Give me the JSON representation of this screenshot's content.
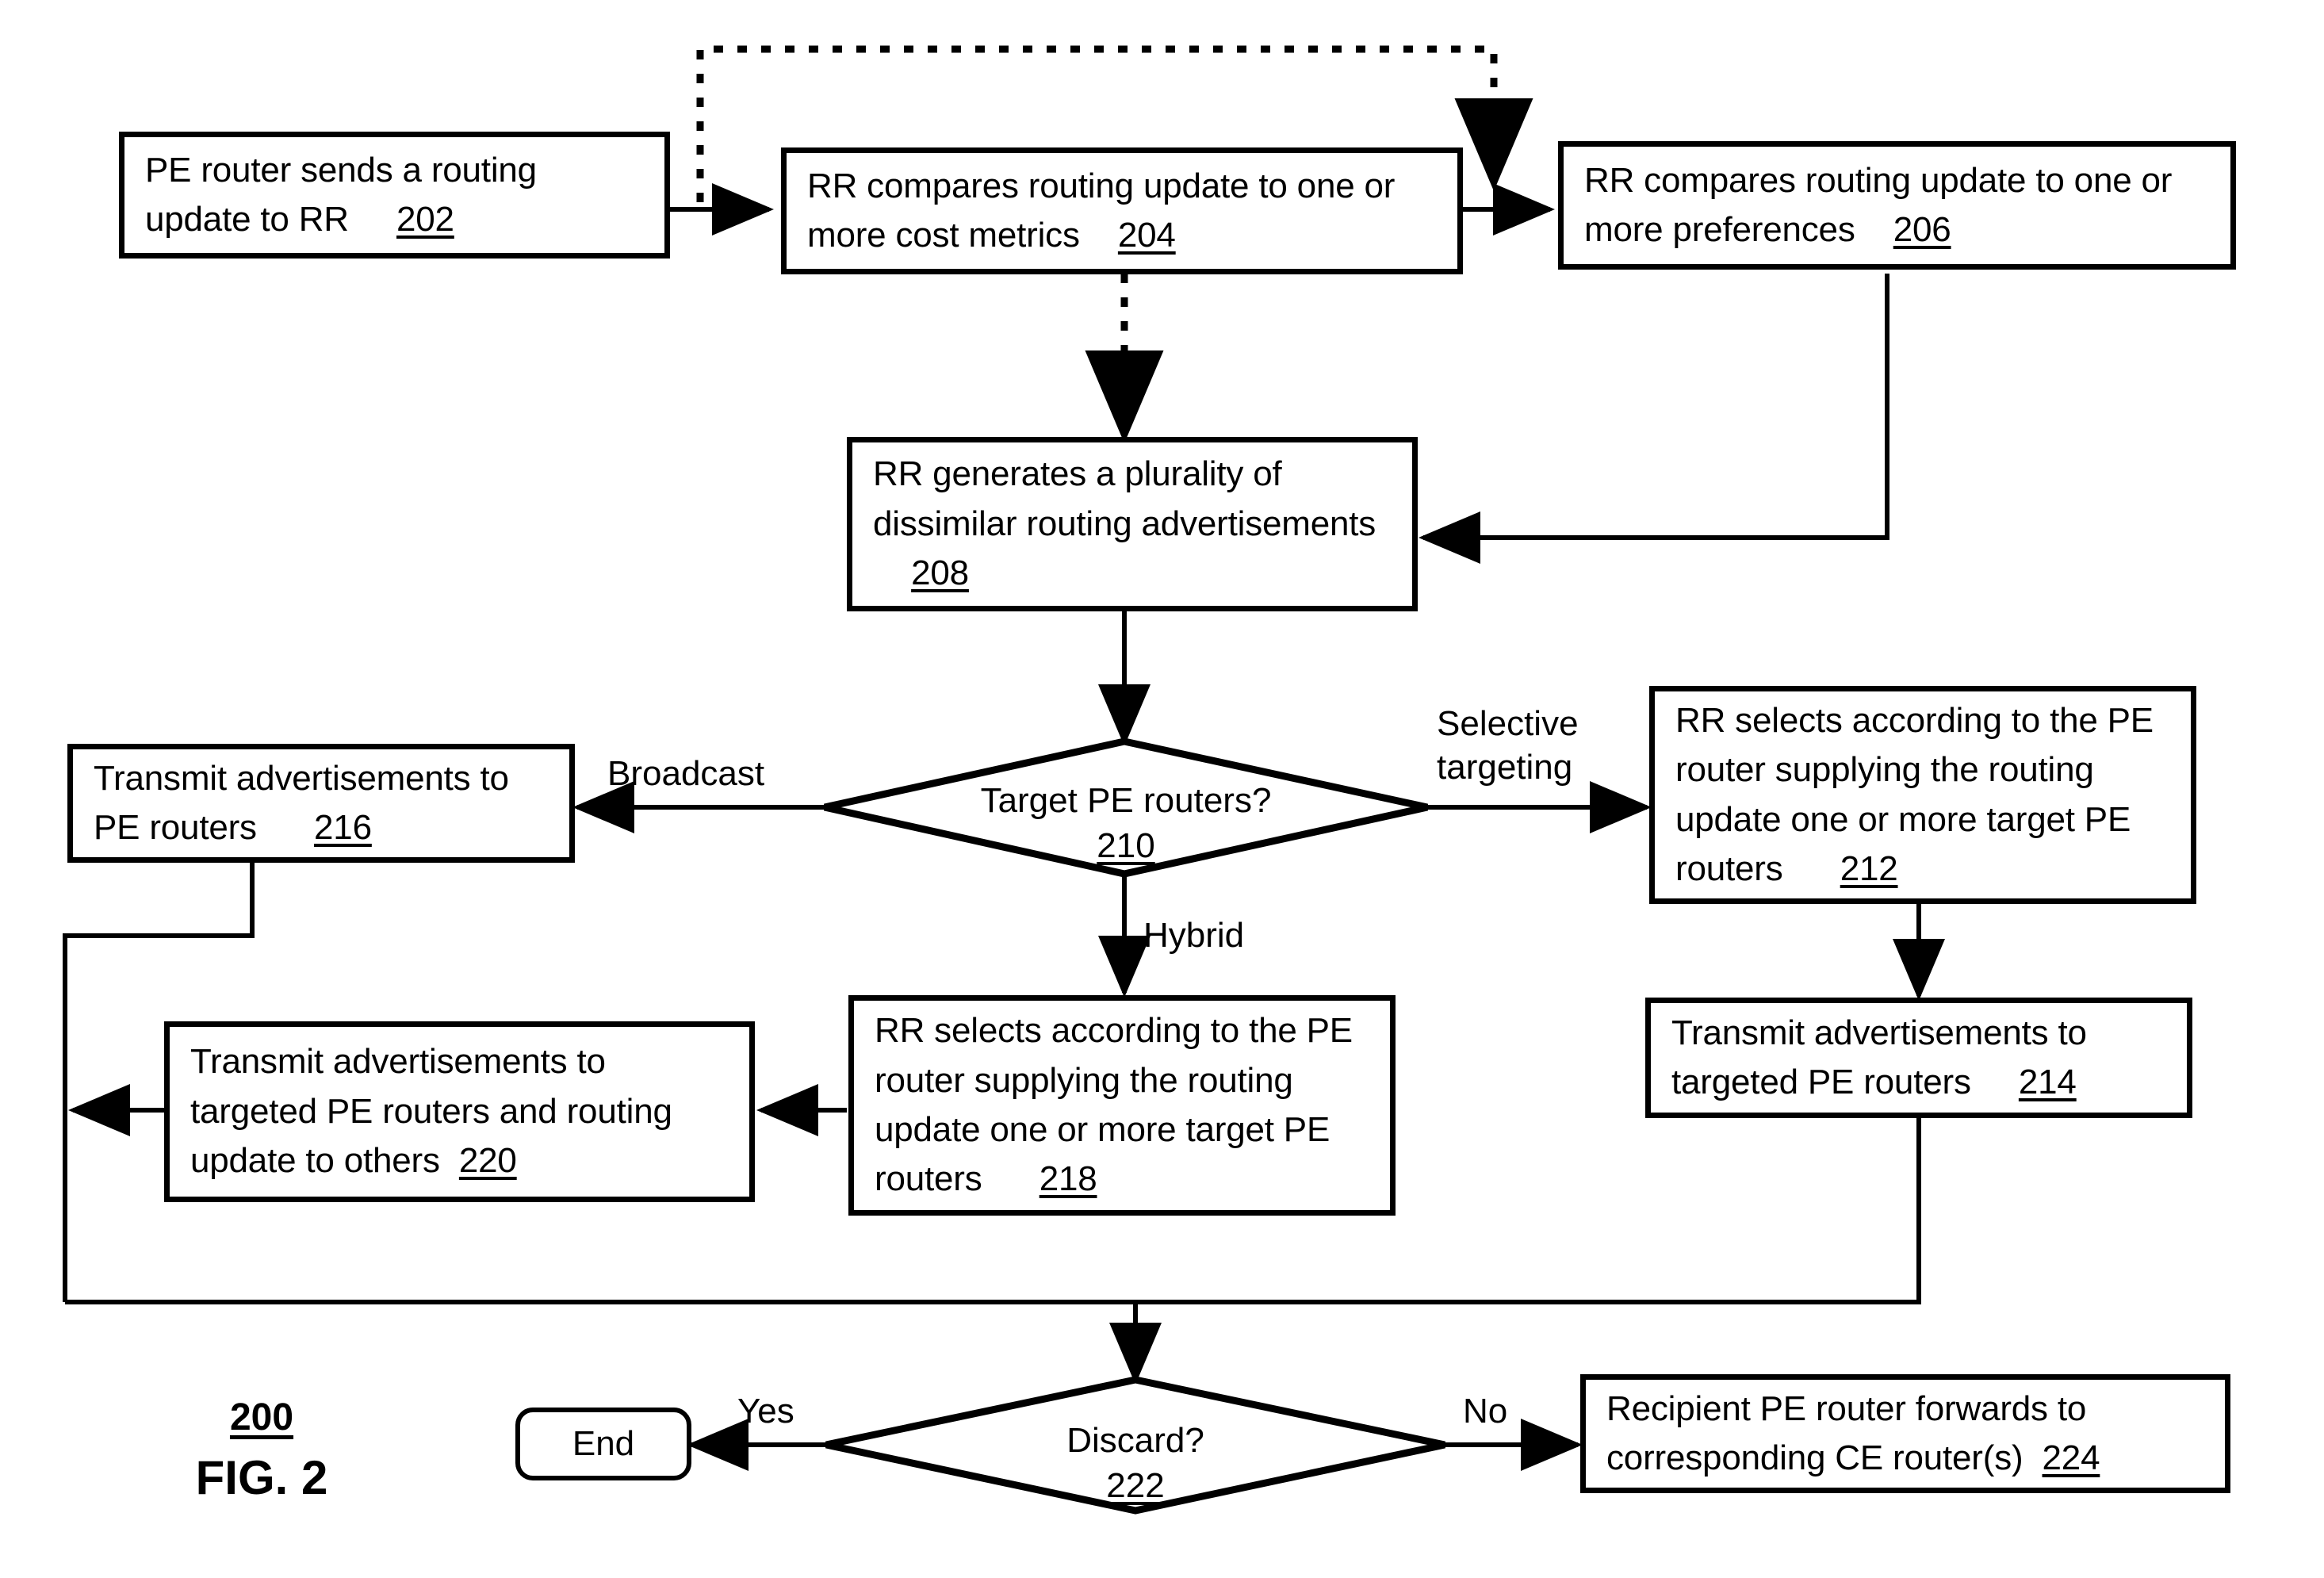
{
  "figure": {
    "number": "200",
    "label": "FIG. 2"
  },
  "nodes": {
    "n202": {
      "text": "PE router sends a routing update to RR",
      "ref": "202"
    },
    "n204": {
      "text": "RR compares routing update to one or more cost metrics",
      "ref": "204"
    },
    "n206": {
      "text": "RR compares routing update to one or more preferences",
      "ref": "206"
    },
    "n208": {
      "text": "RR generates a plurality of dissimilar routing advertisements",
      "ref": "208"
    },
    "n210": {
      "text": "Target PE routers?",
      "ref": "210"
    },
    "n212": {
      "text": "RR selects according to the PE router supplying the routing update one or more target PE routers",
      "ref": "212"
    },
    "n214": {
      "text": "Transmit advertisements to targeted PE routers",
      "ref": "214"
    },
    "n216": {
      "text": "Transmit advertisements to PE routers",
      "ref": "216"
    },
    "n218": {
      "text": "RR selects according to the PE router supplying the routing update one or more target PE routers",
      "ref": "218"
    },
    "n220": {
      "text": "Transmit advertisements to targeted PE routers and routing update to others",
      "ref": "220"
    },
    "n222": {
      "text": "Discard?",
      "ref": "222"
    },
    "n224": {
      "text": "Recipient PE router forwards to corresponding CE router(s)",
      "ref": "224"
    },
    "end": {
      "text": "End"
    }
  },
  "edge_labels": {
    "broadcast": "Broadcast",
    "selective_targeting": "Selective\ntargeting",
    "hybrid": "Hybrid",
    "yes": "Yes",
    "no": "No"
  },
  "chart_data": {
    "type": "diagram",
    "title": "FIG. 2",
    "diagram_kind": "flowchart",
    "steps": [
      {
        "id": "202",
        "label": "PE router sends a routing update to RR",
        "shape": "process"
      },
      {
        "id": "204",
        "label": "RR compares routing update to one or more cost metrics",
        "shape": "process"
      },
      {
        "id": "206",
        "label": "RR compares routing update to one or more preferences",
        "shape": "process"
      },
      {
        "id": "208",
        "label": "RR generates a plurality of dissimilar routing advertisements",
        "shape": "process"
      },
      {
        "id": "210",
        "label": "Target PE routers?",
        "shape": "decision"
      },
      {
        "id": "212",
        "label": "RR selects according to the PE router supplying the routing update one or more target PE routers",
        "shape": "process"
      },
      {
        "id": "214",
        "label": "Transmit advertisements to targeted PE routers",
        "shape": "process"
      },
      {
        "id": "216",
        "label": "Transmit advertisements to PE routers",
        "shape": "process"
      },
      {
        "id": "218",
        "label": "RR selects according to the PE router supplying the routing update one or more target PE routers",
        "shape": "process"
      },
      {
        "id": "220",
        "label": "Transmit advertisements to targeted PE routers and routing update to others",
        "shape": "process"
      },
      {
        "id": "222",
        "label": "Discard?",
        "shape": "decision"
      },
      {
        "id": "224",
        "label": "Recipient PE router forwards to corresponding CE router(s)",
        "shape": "process"
      },
      {
        "id": "end",
        "label": "End",
        "shape": "terminator"
      }
    ],
    "edges": [
      {
        "from": "202",
        "to": "204",
        "label": "",
        "style": "solid"
      },
      {
        "from": "204",
        "to": "206",
        "label": "",
        "style": "solid"
      },
      {
        "from": "206",
        "to": "208",
        "label": "",
        "style": "solid"
      },
      {
        "from": "204",
        "to": "208",
        "label": "",
        "style": "dashed"
      },
      {
        "from": "202",
        "to": "206",
        "label": "",
        "style": "dashed"
      },
      {
        "from": "208",
        "to": "210",
        "label": "",
        "style": "solid"
      },
      {
        "from": "210",
        "to": "216",
        "label": "Broadcast",
        "style": "solid"
      },
      {
        "from": "210",
        "to": "212",
        "label": "Selective targeting",
        "style": "solid"
      },
      {
        "from": "210",
        "to": "218",
        "label": "Hybrid",
        "style": "solid"
      },
      {
        "from": "212",
        "to": "214",
        "label": "",
        "style": "solid"
      },
      {
        "from": "218",
        "to": "220",
        "label": "",
        "style": "solid"
      },
      {
        "from": "216",
        "to": "222",
        "label": "",
        "style": "solid"
      },
      {
        "from": "220",
        "to": "222",
        "label": "",
        "style": "solid"
      },
      {
        "from": "214",
        "to": "222",
        "label": "",
        "style": "solid"
      },
      {
        "from": "222",
        "to": "end",
        "label": "Yes",
        "style": "solid"
      },
      {
        "from": "222",
        "to": "224",
        "label": "No",
        "style": "solid"
      }
    ]
  }
}
